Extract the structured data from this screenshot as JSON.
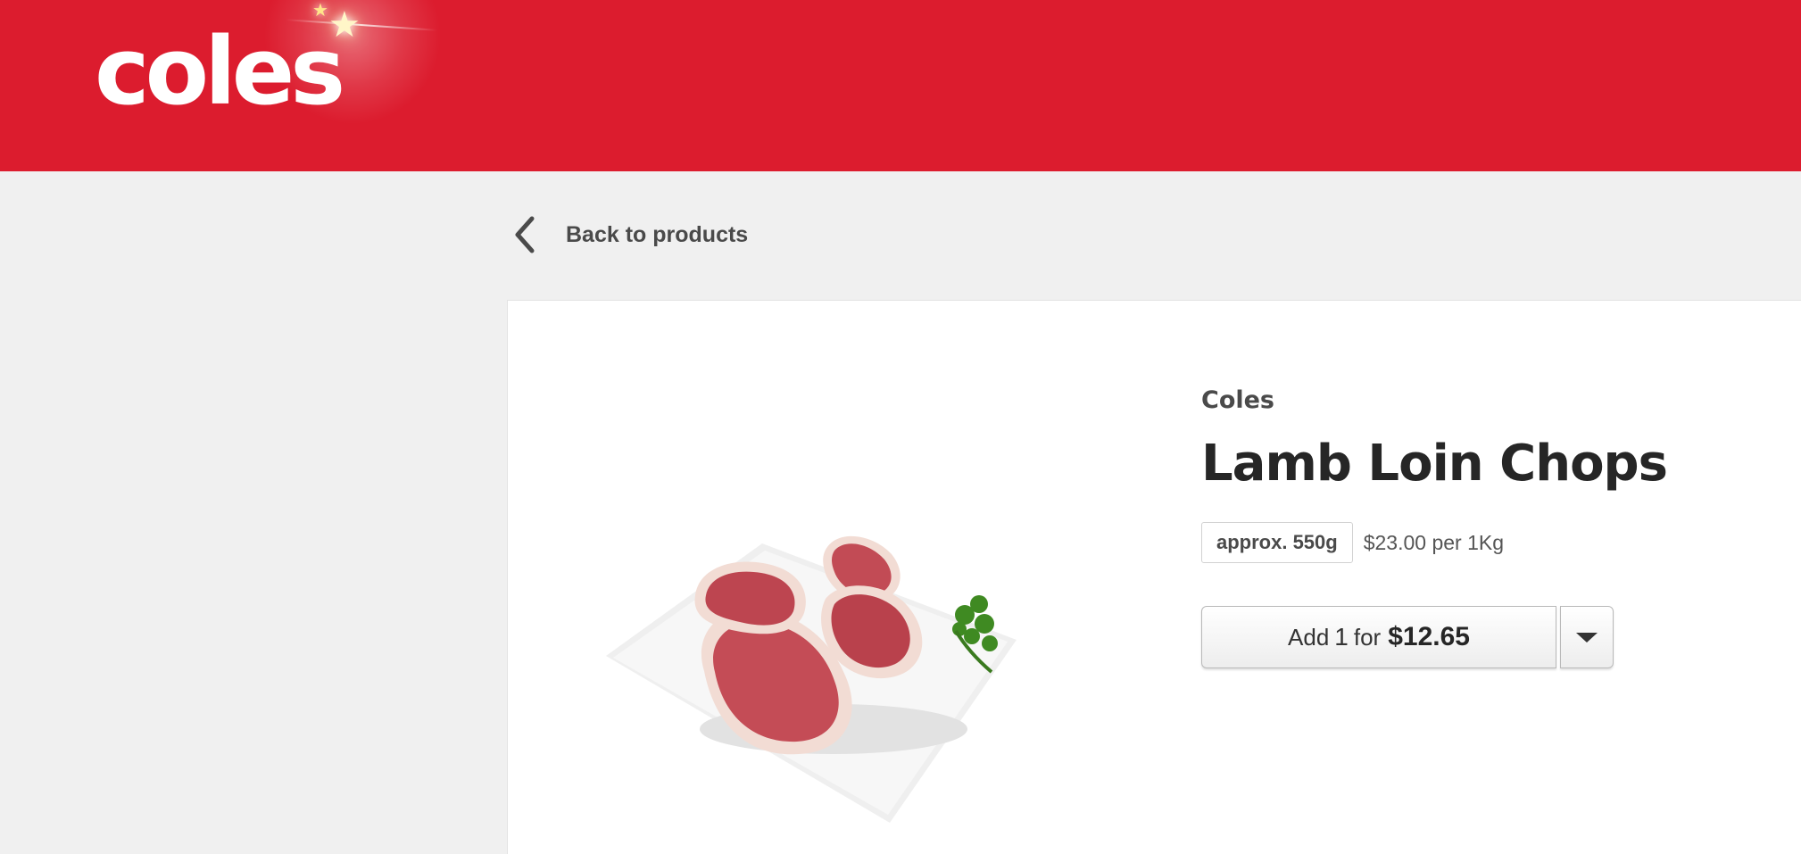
{
  "header": {
    "logo_text": "coles",
    "logo_icon": "star-icon",
    "brand_color": "#dc1c2e"
  },
  "nav": {
    "back_label": "Back to products",
    "back_icon": "chevron-left-icon"
  },
  "product": {
    "brand": "Coles",
    "name": "Lamb Loin Chops",
    "size": "approx. 550g",
    "unit_price": "$23.00 per 1Kg",
    "image_alt": "Lamb Loin Chops",
    "add_button": {
      "prefix": "Add",
      "quantity": "1",
      "for_text": "for",
      "price": "$12.65"
    },
    "dropdown_icon": "caret-down-icon"
  }
}
